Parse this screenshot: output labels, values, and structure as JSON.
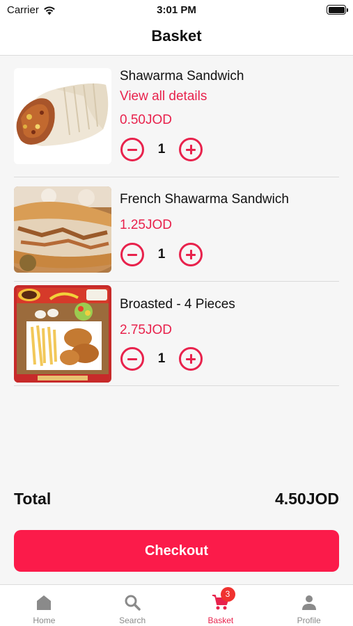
{
  "status_bar": {
    "carrier": "Carrier",
    "time": "3:01 PM"
  },
  "header": {
    "title": "Basket"
  },
  "items": [
    {
      "name": "Shawarma Sandwich",
      "link": "View all details",
      "price": "0.50JOD",
      "quantity": "1",
      "image": "shawarma-wrap"
    },
    {
      "name": "French Shawarma Sandwich",
      "price": "1.25JOD",
      "quantity": "1",
      "image": "french-shawarma"
    },
    {
      "name": "Broasted - 4 Pieces",
      "price": "2.75JOD",
      "quantity": "1",
      "image": "broasted-meal"
    }
  ],
  "total": {
    "label": "Total",
    "value": "4.50JOD"
  },
  "checkout": {
    "label": "Checkout"
  },
  "tabs": [
    {
      "label": "Home",
      "icon": "home-icon"
    },
    {
      "label": "Search",
      "icon": "search-icon"
    },
    {
      "label": "Basket",
      "icon": "cart-icon",
      "badge": "3",
      "active": true
    },
    {
      "label": "Profile",
      "icon": "person-icon"
    }
  ],
  "colors": {
    "accent": "#e8224c",
    "checkout": "#fb1b4a",
    "badge": "#f0322f",
    "inactive": "#8a8a8a"
  }
}
